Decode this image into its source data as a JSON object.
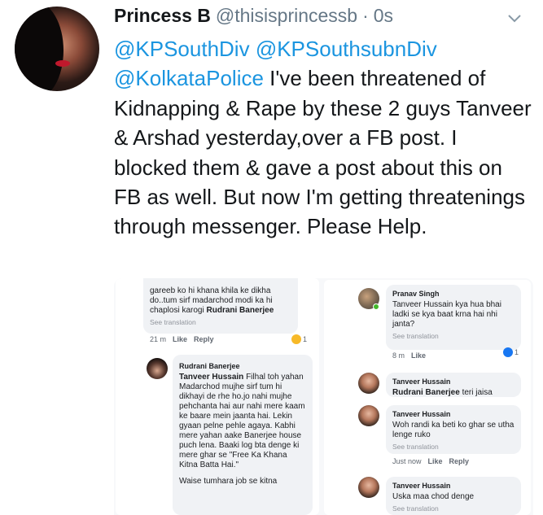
{
  "tweet": {
    "author_name": "Princess B",
    "author_handle": "@thisisprincessb",
    "separator": "·",
    "time": "0s",
    "mention_1": "@KPSouthDiv",
    "mention_2": "@KPSouthsubnDiv",
    "mention_3": "@KolkataPolice",
    "body": "I've been threatened of Kidnapping & Rape by these 2 guys Tanveer & Arshad yesterday,over a FB post. I blocked them & gave a post about this on FB as well. But now I'm getting threatenings through messenger. Please Help.",
    "menu_icon": "chevron-down-icon",
    "mention_color": "#1b95e0"
  },
  "screenshot": {
    "left_c1": {
      "text": "gareeb ko hi khana khila ke dikha do..tum sirf madarchod modi ka hi chaplosi karogi",
      "tag": "Rudrani Banerjee",
      "see_translation": "See translation",
      "time": "21 m",
      "like": "Like",
      "reply": "Reply",
      "reaction_count": "1"
    },
    "left_c2": {
      "name": "Rudrani Banerjee",
      "tag": "Tanveer Hussain",
      "text": "Filhal toh yahan Madarchod mujhe sirf tum hi dikhayi de rhe ho.jo nahi mujhe pehchanta hai aur nahi mere kaam ke baare mein jaanta hai. Lekin gyaan pelne pehle agaya. Kabhi mere yahan aake Banerjee house puch lena. Baaki log bta denge ki mere ghar se \"Free Ka Khana Kitna Batta Hai.\"",
      "cut_text": "Waise tumhara job se kitna"
    },
    "right_c1": {
      "name": "Pranav Singh",
      "text": "Tanveer Hussain kya hua bhai ladki se kya baat krna hai nhi janta?",
      "see_translation": "See translation",
      "time": "8 m",
      "like": "Like",
      "reaction_count": "1"
    },
    "right_c2": {
      "name": "Tanveer Hussain",
      "tag": "Rudrani Banerjee",
      "text": "teri jaisa"
    },
    "right_c3": {
      "name": "Tanveer Hussain",
      "text": "Woh randi ka beti ko ghar se utha lenge ruko",
      "see_translation": "See translation",
      "time": "Just now",
      "like": "Like",
      "reply": "Reply"
    },
    "right_c4": {
      "name": "Tanveer Hussain",
      "text": "Uska maa chod denge",
      "see_translation": "See translation"
    }
  }
}
